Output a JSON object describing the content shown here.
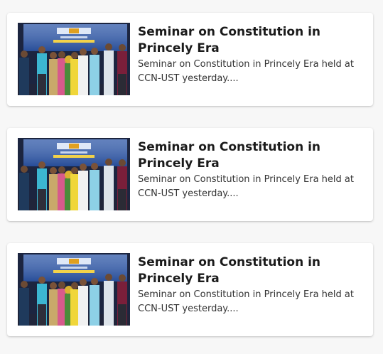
{
  "articles": [
    {
      "title": "Seminar on Constitution in Princely Era",
      "excerpt": "Seminar on Constitution in Princely Era held at CCN-UST yesterday....",
      "image_icon": "seminar-group-photo"
    },
    {
      "title": "Seminar on Constitution in Princely Era",
      "excerpt": "Seminar on Constitution in Princely Era held at CCN-UST yesterday....",
      "image_icon": "seminar-group-photo"
    },
    {
      "title": "Seminar on Constitution in Princely Era",
      "excerpt": "Seminar on Constitution in Princely Era held at CCN-UST yesterday....",
      "image_icon": "seminar-group-photo"
    }
  ]
}
